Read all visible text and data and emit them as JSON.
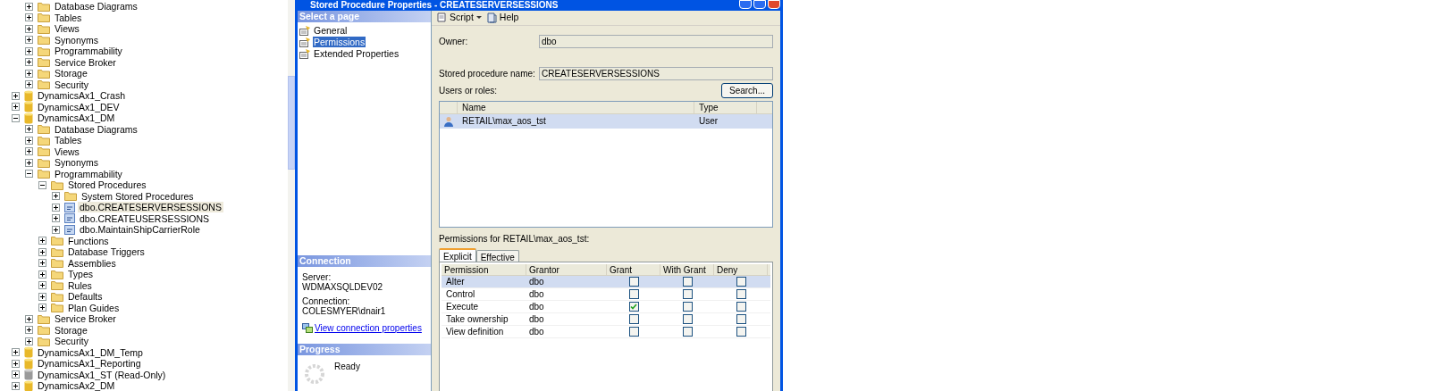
{
  "tree": {
    "orphan_children": [
      {
        "label": "Database Diagrams",
        "kind": "folder",
        "expanded": false,
        "selected": false
      },
      {
        "label": "Tables",
        "kind": "folder",
        "expanded": false,
        "selected": false
      },
      {
        "label": "Views",
        "kind": "folder",
        "expanded": false,
        "selected": false
      },
      {
        "label": "Synonyms",
        "kind": "folder",
        "expanded": false,
        "selected": false
      },
      {
        "label": "Programmability",
        "kind": "folder",
        "expanded": false,
        "selected": false
      },
      {
        "label": "Service Broker",
        "kind": "folder",
        "expanded": false,
        "selected": false
      },
      {
        "label": "Storage",
        "kind": "folder",
        "expanded": false,
        "selected": false
      },
      {
        "label": "Security",
        "kind": "folder",
        "expanded": false,
        "selected": false
      }
    ],
    "databases": [
      {
        "label": "DynamicsAx1_Crash",
        "kind": "database",
        "expanded": false,
        "selected": false
      },
      {
        "label": "DynamicsAx1_DEV",
        "kind": "database",
        "expanded": false,
        "selected": false
      },
      {
        "label": "DynamicsAx1_DM",
        "kind": "database",
        "expanded": true,
        "selected": false,
        "children": [
          {
            "label": "Database Diagrams",
            "kind": "folder",
            "expanded": false,
            "selected": false
          },
          {
            "label": "Tables",
            "kind": "folder",
            "expanded": false,
            "selected": false
          },
          {
            "label": "Views",
            "kind": "folder",
            "expanded": false,
            "selected": false
          },
          {
            "label": "Synonyms",
            "kind": "folder",
            "expanded": false,
            "selected": false
          },
          {
            "label": "Programmability",
            "kind": "folder",
            "expanded": true,
            "selected": false,
            "children": [
              {
                "label": "Stored Procedures",
                "kind": "folder",
                "expanded": true,
                "selected": false,
                "children": [
                  {
                    "label": "System Stored Procedures",
                    "kind": "folder",
                    "expanded": false,
                    "selected": false
                  },
                  {
                    "label": "dbo.CREATESERVERSESSIONS",
                    "kind": "procedure",
                    "expanded": false,
                    "selected": true
                  },
                  {
                    "label": "dbo.CREATEUSERSESSIONS",
                    "kind": "procedure",
                    "expanded": false,
                    "selected": false
                  },
                  {
                    "label": "dbo.MaintainShipCarrierRole",
                    "kind": "procedure",
                    "expanded": false,
                    "selected": false
                  }
                ]
              },
              {
                "label": "Functions",
                "kind": "folder",
                "expanded": false,
                "selected": false
              },
              {
                "label": "Database Triggers",
                "kind": "folder",
                "expanded": false,
                "selected": false
              },
              {
                "label": "Assemblies",
                "kind": "folder",
                "expanded": false,
                "selected": false
              },
              {
                "label": "Types",
                "kind": "folder",
                "expanded": false,
                "selected": false
              },
              {
                "label": "Rules",
                "kind": "folder",
                "expanded": false,
                "selected": false
              },
              {
                "label": "Defaults",
                "kind": "folder",
                "expanded": false,
                "selected": false
              },
              {
                "label": "Plan Guides",
                "kind": "folder",
                "expanded": false,
                "selected": false
              }
            ]
          },
          {
            "label": "Service Broker",
            "kind": "folder",
            "expanded": false,
            "selected": false
          },
          {
            "label": "Storage",
            "kind": "folder",
            "expanded": false,
            "selected": false
          },
          {
            "label": "Security",
            "kind": "folder",
            "expanded": false,
            "selected": false
          }
        ]
      },
      {
        "label": "DynamicsAx1_DM_Temp",
        "kind": "database",
        "expanded": false,
        "selected": false
      },
      {
        "label": "DynamicsAx1_Reporting",
        "kind": "database",
        "expanded": false,
        "selected": false
      },
      {
        "label": "DynamicsAx1_ST (Read-Only)",
        "kind": "database_readonly",
        "expanded": false,
        "selected": false
      },
      {
        "label": "DynamicsAx2_DM",
        "kind": "database",
        "expanded": false,
        "selected": false
      }
    ]
  },
  "dialog": {
    "title": "Stored Procedure Properties - CREATESERVERSESSIONS",
    "select_page_header": "Select a page",
    "pages": [
      {
        "label": "General",
        "selected": false
      },
      {
        "label": "Permissions",
        "selected": true
      },
      {
        "label": "Extended Properties",
        "selected": false
      }
    ],
    "connection": {
      "header": "Connection",
      "server_label": "Server:",
      "server": "WDMAXSQLDEV02",
      "connection_label": "Connection:",
      "connection": "COLESMYER\\dnair1",
      "link": "View connection properties"
    },
    "progress": {
      "header": "Progress",
      "status": "Ready"
    },
    "toolbar": {
      "script": "Script",
      "help": "Help"
    },
    "owner_label": "Owner:",
    "owner": "dbo",
    "name_label": "Stored procedure name:",
    "name": "CREATESERVERSESSIONS",
    "users_label": "Users or roles:",
    "search_button": "Search...",
    "users_table": {
      "columns": [
        "Name",
        "Type"
      ],
      "rows": [
        {
          "name": "RETAIL\\max_aos_tst",
          "type": "User",
          "selected": true
        }
      ]
    },
    "permissions_label": "Permissions for RETAIL\\max_aos_tst:",
    "tabs": [
      {
        "label": "Explicit",
        "selected": true
      },
      {
        "label": "Effective",
        "selected": false
      }
    ],
    "permissions_table": {
      "columns": [
        "Permission",
        "Grantor",
        "Grant",
        "With Grant",
        "Deny"
      ],
      "rows": [
        {
          "permission": "Alter",
          "grantor": "dbo",
          "grant": false,
          "with_grant": false,
          "deny": false,
          "selected": true
        },
        {
          "permission": "Control",
          "grantor": "dbo",
          "grant": false,
          "with_grant": false,
          "deny": false,
          "selected": false
        },
        {
          "permission": "Execute",
          "grantor": "dbo",
          "grant": true,
          "with_grant": false,
          "deny": false,
          "selected": false
        },
        {
          "permission": "Take ownership",
          "grantor": "dbo",
          "grant": false,
          "with_grant": false,
          "deny": false,
          "selected": false
        },
        {
          "permission": "View definition",
          "grantor": "dbo",
          "grant": false,
          "with_grant": false,
          "deny": false,
          "selected": false
        }
      ]
    }
  }
}
